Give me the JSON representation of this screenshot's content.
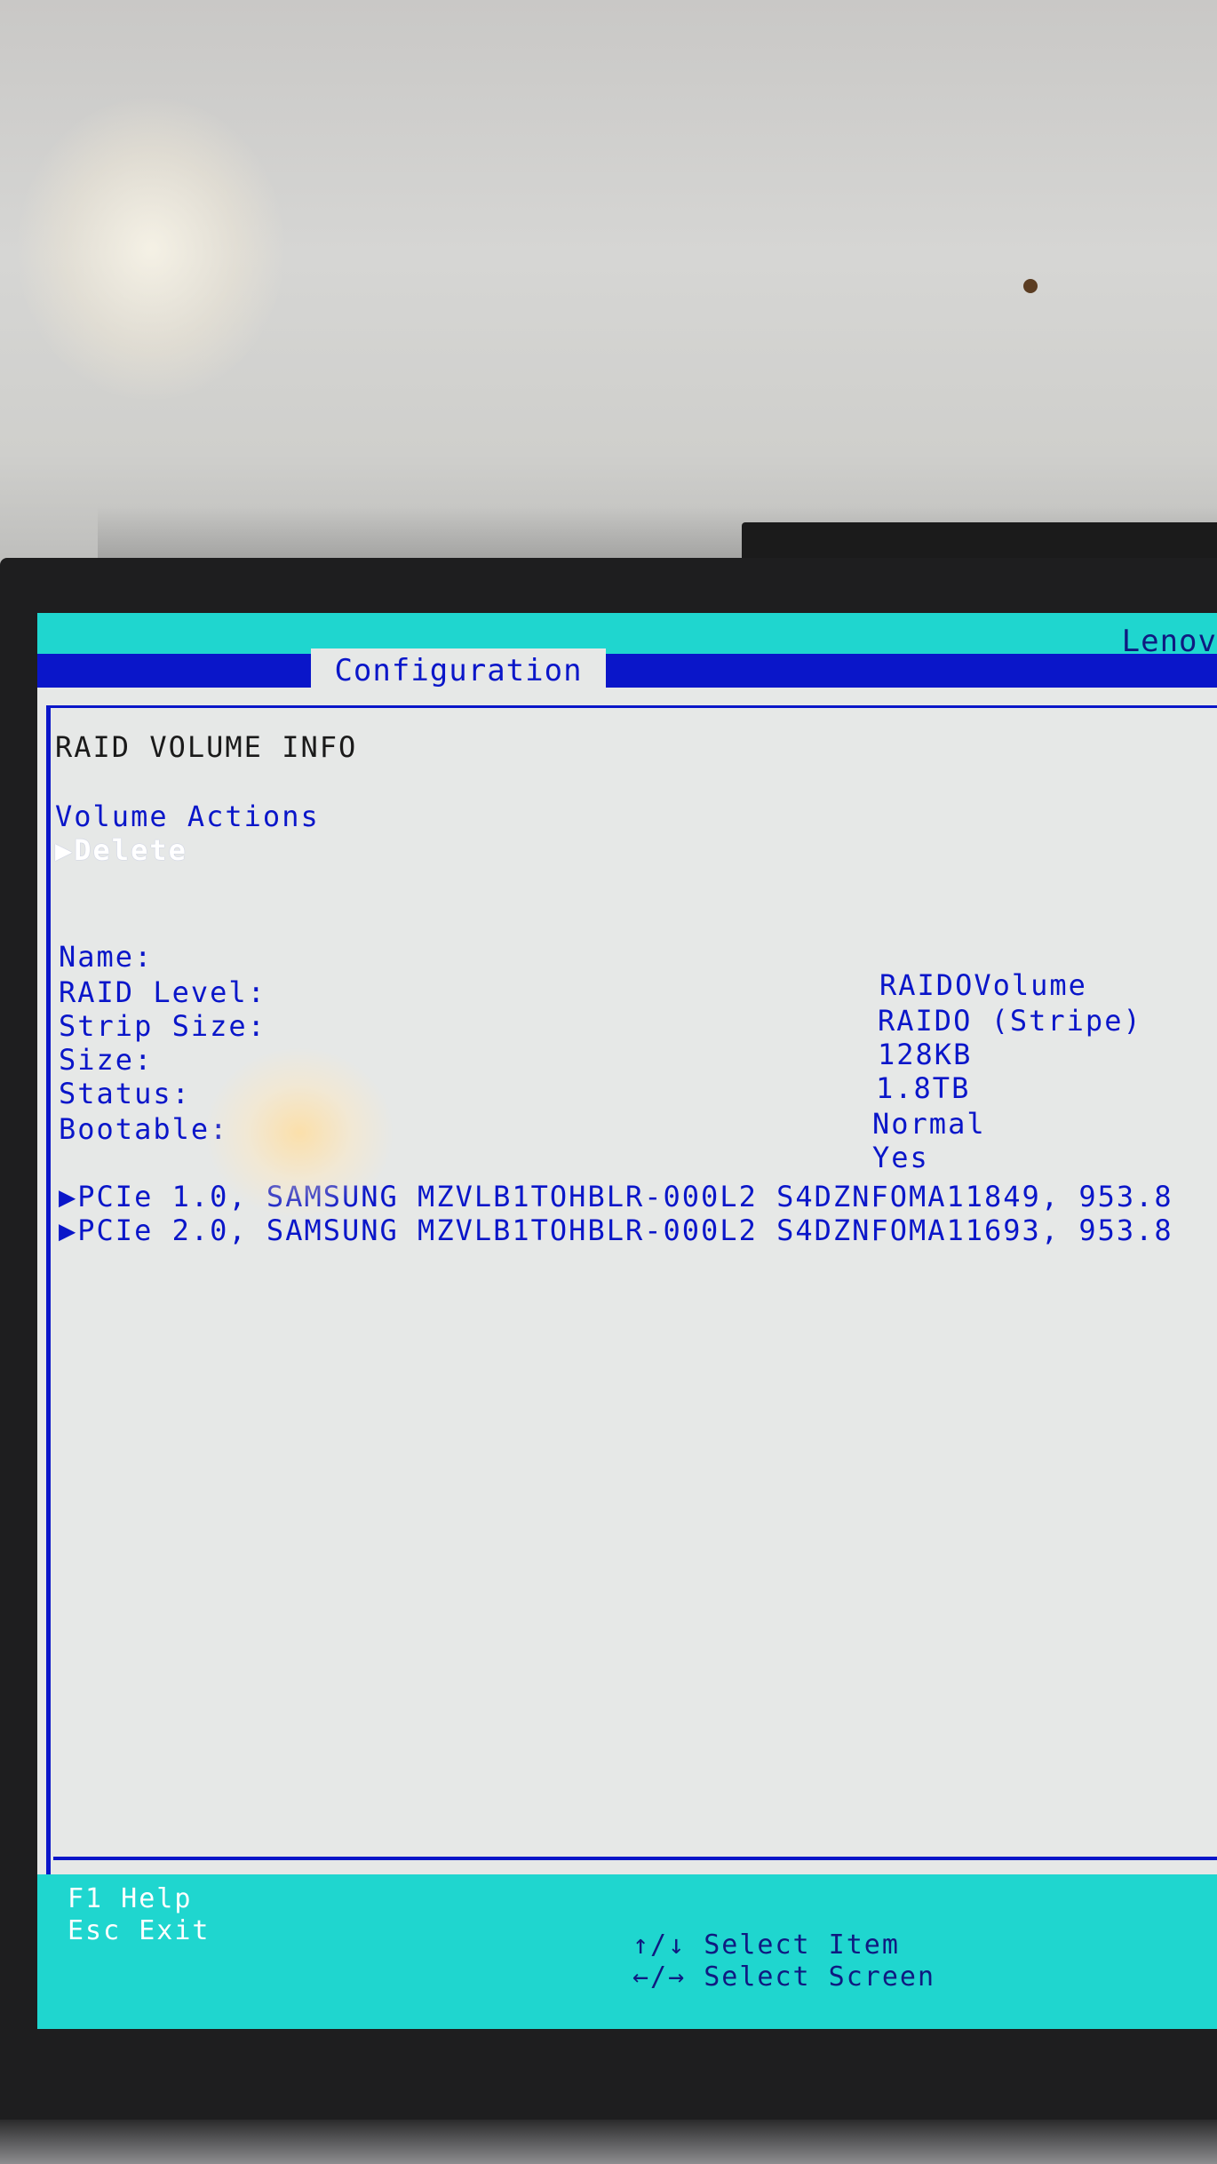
{
  "header": {
    "brand": "Lenov",
    "active_tab": "Configuration"
  },
  "page": {
    "title": "RAID VOLUME INFO",
    "volume_actions": {
      "heading": "Volume Actions",
      "delete_label": "▶Delete"
    },
    "fields": [
      {
        "label": "Name:"
      },
      {
        "label": "RAID Level:"
      },
      {
        "label": "Strip Size:"
      },
      {
        "label": "Size:"
      },
      {
        "label": "Status:"
      },
      {
        "label": "Bootable:"
      }
    ],
    "values": [
      "RAIDOVolume",
      "RAIDO (Stripe)",
      "128KB",
      "1.8TB",
      "Normal",
      "Yes"
    ],
    "drives": [
      "▶PCIe 1.0, SAMSUNG MZVLB1TOHBLR-000L2 S4DZNFOMA11849, 953.8",
      "▶PCIe 2.0, SAMSUNG MZVLB1TOHBLR-000L2 S4DZNFOMA11693, 953.8"
    ]
  },
  "footer": {
    "help_key": "F1  Help",
    "exit_key": "Esc Exit",
    "select_item": "↑/↓ Select Item",
    "select_screen": "←/→ Select Screen"
  },
  "colors": {
    "accent_cyan": "#1fd6cf",
    "accent_blue": "#0a16c9",
    "screen_bg": "#e6e8e7"
  }
}
